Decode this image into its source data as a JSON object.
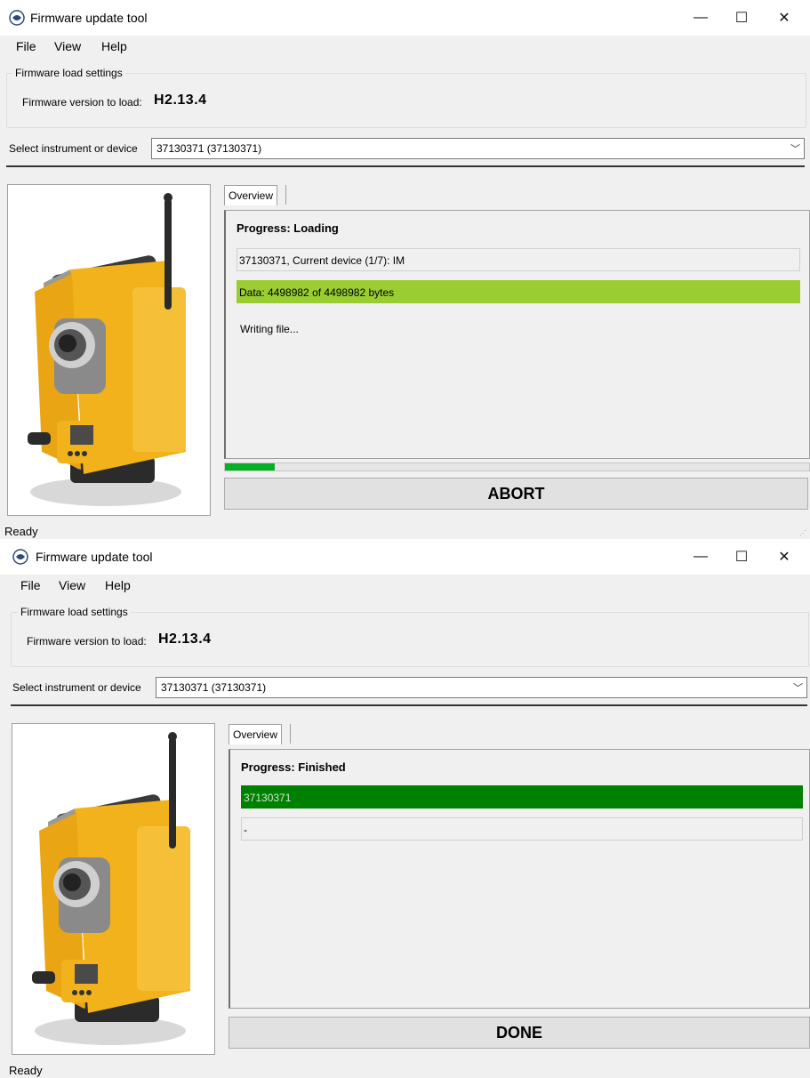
{
  "colors": {
    "row_green": "#9acd32",
    "row_dark_green": "#008000",
    "progress_green": "#06b025",
    "instrument_yellow": "#f2b21b"
  },
  "icons": {
    "app": "trimble-logo-icon",
    "minimize": "minimize-icon",
    "maximize": "maximize-icon",
    "close": "close-icon",
    "dropdown": "chevron-down-icon",
    "grip": "resize-grip-icon"
  },
  "windows": [
    {
      "title": "Firmware update tool",
      "menu": [
        "File",
        "View",
        "Help"
      ],
      "group_title": "Firmware load settings",
      "fw_label": "Firmware version to load:",
      "fw_value": "H2.13.4",
      "select_label": "Select instrument or device",
      "select_value": "37130371 (37130371)",
      "tab_label": "Overview",
      "progress_title": "Progress: Loading",
      "row1": "37130371, Current device (1/7): IM",
      "row2": "Data: 4498982 of 4498982 bytes",
      "writing_text": "Writing file...",
      "progress_fraction": 0.085,
      "action_label": "ABORT",
      "status_text": "Ready"
    },
    {
      "title": "Firmware update tool",
      "menu": [
        "File",
        "View",
        "Help"
      ],
      "group_title": "Firmware load settings",
      "fw_label": "Firmware version to load:",
      "fw_value": "H2.13.4",
      "select_label": "Select instrument or device",
      "select_value": "37130371 (37130371)",
      "tab_label": "Overview",
      "progress_title": "Progress: Finished",
      "row1": "37130371",
      "row2": "-",
      "action_label": "DONE",
      "status_text": "Ready"
    }
  ]
}
